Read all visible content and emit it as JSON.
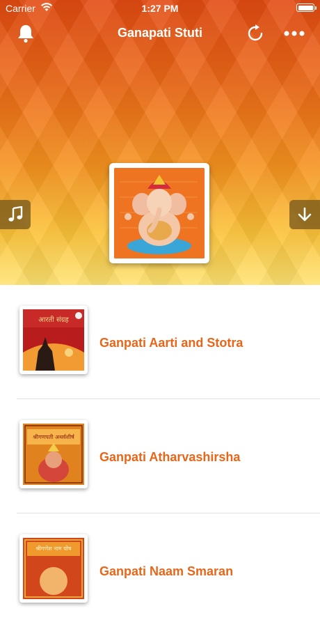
{
  "status_bar": {
    "carrier": "Carrier",
    "time": "1:27 PM",
    "battery_level": 1.0
  },
  "navbar": {
    "title": "Ganapati Stuti"
  },
  "colors": {
    "accent": "#e8661a",
    "side_button": "#7a5a1e",
    "header_top": "#e24a12",
    "header_bottom": "#fde373"
  },
  "icons": {
    "left": "bell-icon",
    "refresh": "refresh-icon",
    "more": "more-icon",
    "music": "music-note-icon",
    "download": "download-icon"
  },
  "list": {
    "items": [
      {
        "title": "Ganpati Aarti and Stotra",
        "thumb_caption": "आरती संग्रह"
      },
      {
        "title": "Ganpati Atharvashirsha",
        "thumb_caption": "श्रीगणपती अथर्वशीर्ष"
      },
      {
        "title": "Ganpati Naam Smaran",
        "thumb_caption": "श्रीगणेश नाम घोष"
      }
    ]
  }
}
